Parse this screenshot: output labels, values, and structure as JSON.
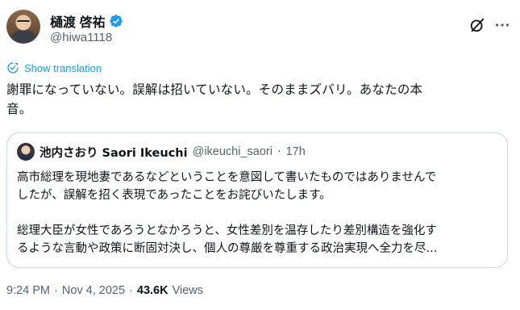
{
  "author": {
    "display_name": "樋渡 啓祐",
    "handle": "@hiwa1118"
  },
  "translate": {
    "label": "Show translation"
  },
  "tweet": {
    "line1": "謝罪になっていない。誤解は招いていない。そのままズバリ。あなたの本",
    "line2": "音。"
  },
  "quote": {
    "display_name": "池内さおり Saori Ikeuchi",
    "handle": "@ikeuchi_saori",
    "separator": "·",
    "time": "17h",
    "para1_line1": "高市総理を現地妻であるなどということを意図して書いたものではありませんで",
    "para1_line2": "したが、誤解を招く表現であったことをお詫びいたします。",
    "para2_line1": "総理大臣が女性であろうとなかろうと、女性差別を温存したり差別構造を強化す",
    "para2_line2": "るような言動や政策に断固対決し、個人の尊厳を尊重する政治実現へ全力を尽..."
  },
  "meta": {
    "time": "9:24 PM",
    "separator1": "·",
    "date": "Nov 4, 2025",
    "separator2": "·",
    "views_count": "43.6K",
    "views_label": "Views"
  },
  "icons": {
    "verified": "verified-badge-icon",
    "grok": "grok-icon",
    "more": "more-options-icon",
    "translate": "translate-icon"
  },
  "colors": {
    "accent": "#1d9bf0",
    "secondary_text": "#536471",
    "border": "#cfd9de"
  }
}
